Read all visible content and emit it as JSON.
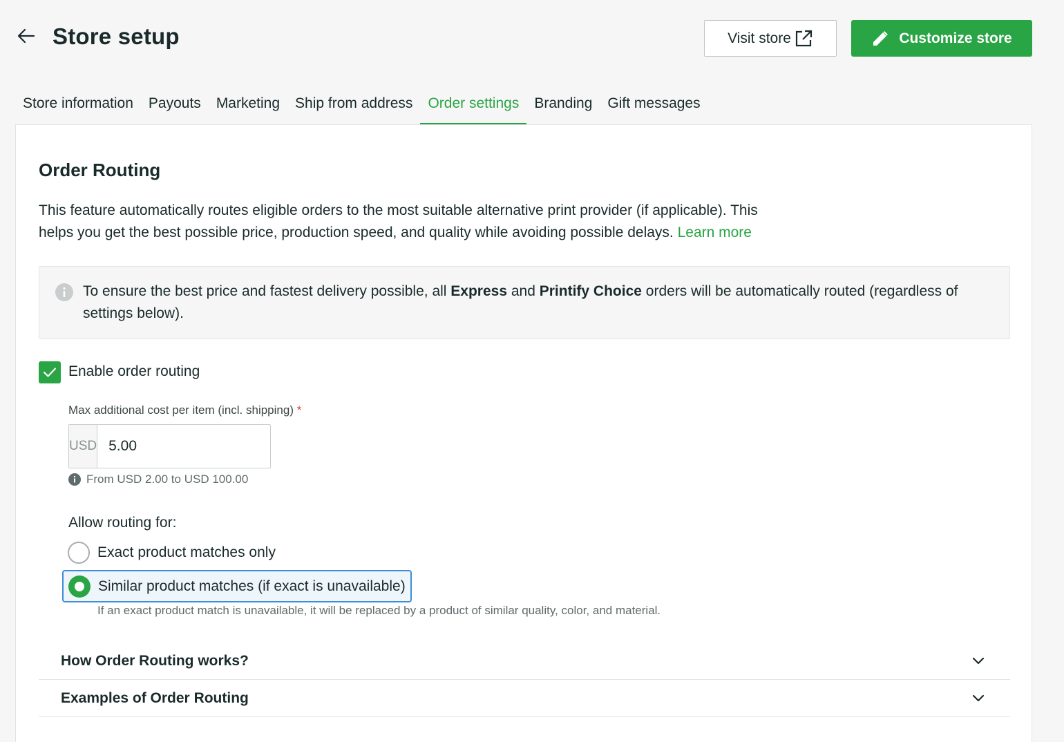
{
  "header": {
    "title": "Store setup",
    "visit_store_label": "Visit store",
    "customize_store_label": "Customize store"
  },
  "tabs": [
    {
      "label": "Store information",
      "active": false
    },
    {
      "label": "Payouts",
      "active": false
    },
    {
      "label": "Marketing",
      "active": false
    },
    {
      "label": "Ship from address",
      "active": false
    },
    {
      "label": "Order settings",
      "active": true
    },
    {
      "label": "Branding",
      "active": false
    },
    {
      "label": "Gift messages",
      "active": false
    }
  ],
  "order_routing": {
    "title": "Order Routing",
    "description": "This feature automatically routes eligible orders to the most suitable alternative print provider (if applicable). This helps you get the best possible price, production speed, and quality while avoiding possible delays.",
    "learn_more": "Learn more",
    "info": {
      "part1": "To ensure the best price and fastest delivery possible, all ",
      "bold1": "Express",
      "part2": " and ",
      "bold2": "Printify Choice",
      "part3": " orders will be automatically routed (regardless of settings below)."
    },
    "enable_label": "Enable order routing",
    "enable_checked": true,
    "max_cost": {
      "label": "Max additional cost per item (incl. shipping)",
      "required_mark": "*",
      "currency": "USD",
      "value": "5.00",
      "hint": "From USD 2.00 to USD 100.00"
    },
    "allow_label": "Allow routing for:",
    "options": [
      {
        "label": "Exact product matches only",
        "selected": false
      },
      {
        "label": "Similar product matches (if exact is unavailable)",
        "selected": true
      }
    ],
    "similar_help": "If an exact product match is unavailable, it will be replaced by a product of similar quality, color, and material."
  },
  "accordions": [
    {
      "title": "How Order Routing works?"
    },
    {
      "title": "Examples of Order Routing"
    }
  ],
  "colors": {
    "accent": "#29a545",
    "focus": "#3c8fd6",
    "required": "#e0383e"
  }
}
